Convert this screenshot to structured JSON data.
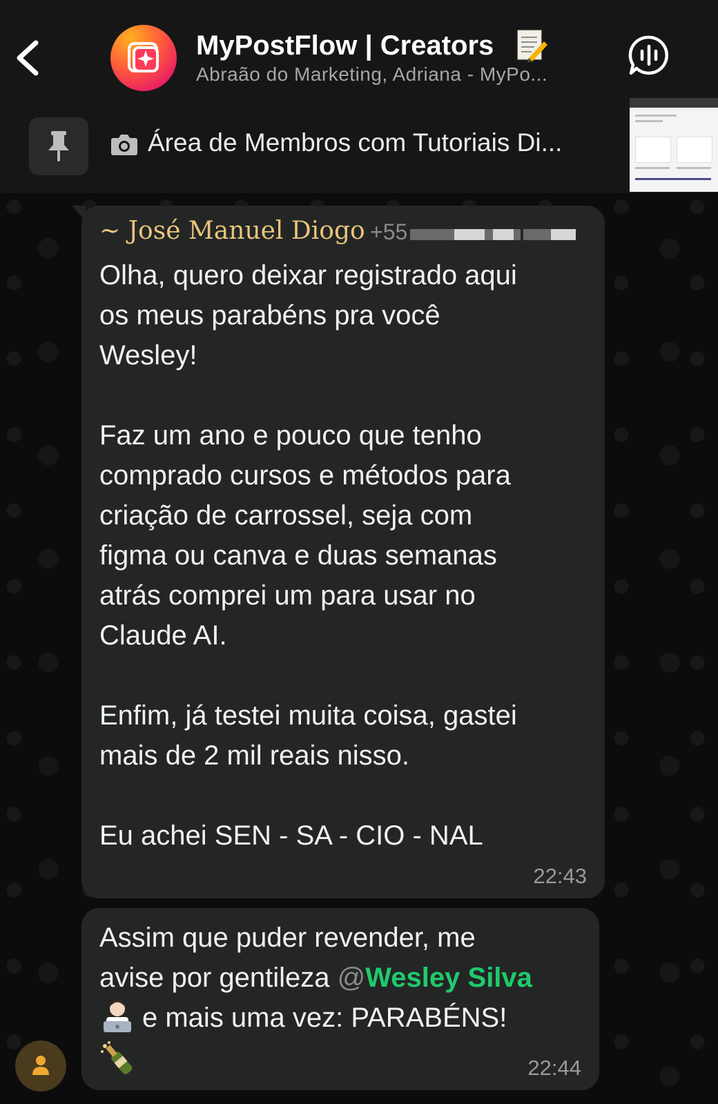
{
  "header": {
    "title": "MyPostFlow | Creators",
    "subtitle": "Abraão do Marketing, Adriana - MyPo...",
    "title_emoji": "memo-icon",
    "avatar_colors": [
      "#ffb020",
      "#ff5a3c",
      "#e91e63"
    ]
  },
  "pinned": {
    "text": "Área de Membros com Tutoriais Di..."
  },
  "messages": [
    {
      "sender": "~ José Manuel Diogo",
      "phone": "+55",
      "body": "Olha, quero deixar registrado aqui\nos meus parabéns pra você\nWesley!\n\nFaz um ano e pouco que tenho\ncomprado cursos e métodos para\ncriação de carrossel, seja com\nfigma ou canva e duas semanas\natrás comprei um para usar no\nClaude AI.\n\nEnfim, já testei muita coisa, gastei\nmais de 2 mil reais nisso.\n\nEu achei SEN - SA - CIO - NAL",
      "time": "22:43"
    },
    {
      "line1": "Assim que puder revender, me",
      "line2_prefix": "avise por gentileza ",
      "mention_at": "@",
      "mention_name": "Wesley Silva",
      "line3": "e mais uma vez: PARABÉNS!",
      "time": "22:44"
    }
  ],
  "colors": {
    "sender": "#e8c47a",
    "mention": "#1fca6b",
    "bubble": "#242626",
    "header_bg": "#161616"
  }
}
